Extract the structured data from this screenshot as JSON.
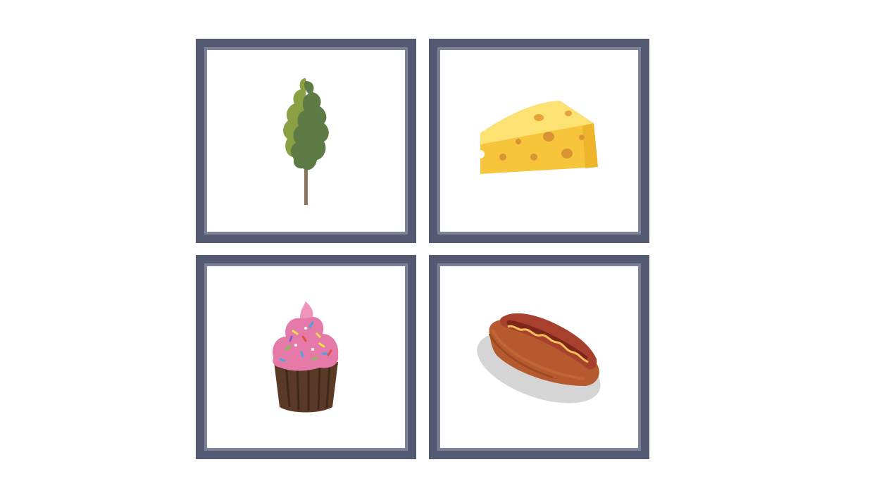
{
  "board": {
    "cards": [
      {
        "picture": "tree-icon"
      },
      {
        "picture": "cheese-icon"
      },
      {
        "picture": "cupcake-icon"
      },
      {
        "picture": "hot-dog-icon"
      }
    ]
  },
  "colors": {
    "card_frame": "#545a72",
    "card_frame_inner": "#7e8299",
    "card_background": "#ffffff"
  }
}
